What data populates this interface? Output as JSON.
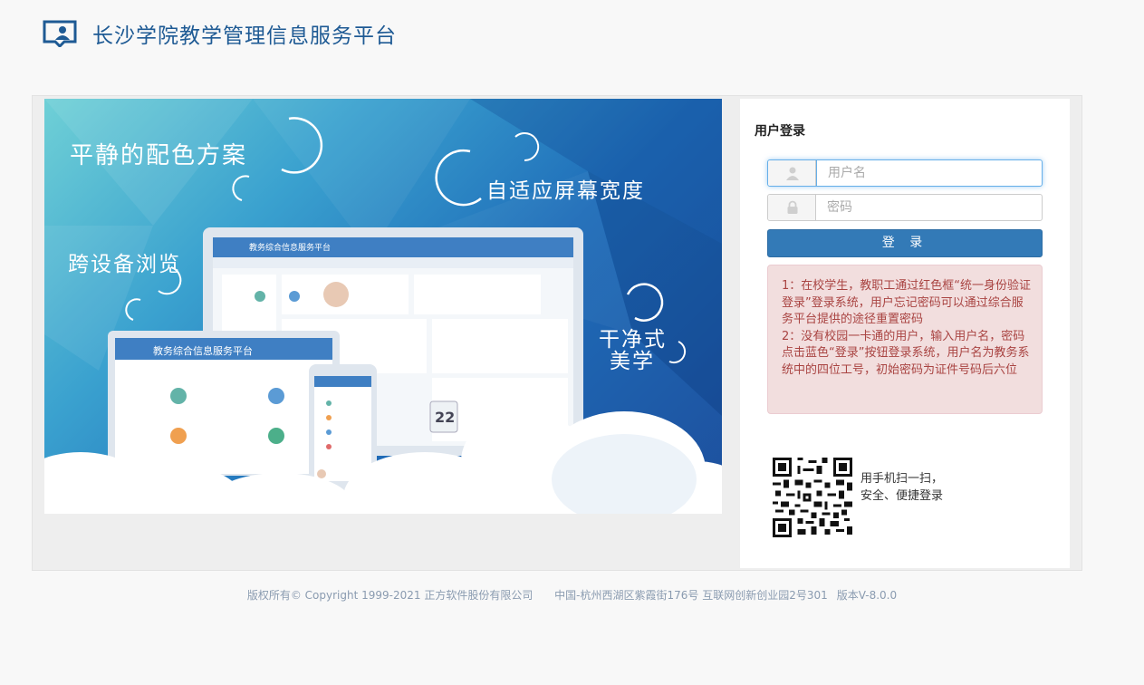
{
  "header": {
    "title": "长沙学院教学管理信息服务平台",
    "logo_icon": "monitor-user-icon"
  },
  "banner": {
    "slogans": [
      "平静的配色方案",
      "自适应屏幕宽度",
      "跨设备浏览",
      "干净式",
      "美学"
    ],
    "device_title": "教务综合信息服务平台",
    "date_number": "22"
  },
  "login": {
    "title": "用户登录",
    "username_placeholder": "用户名",
    "password_placeholder": "密码",
    "button_label": "登 录",
    "notice_1": "1：在校学生，教职工通过红色框“统一身份验证登录”登录系统，用户忘记密码可以通过综合服务平台提供的途径重置密码",
    "notice_2": "2：没有校园一卡通的用户，输入用户名，密码点击蓝色“登录”按钮登录系统，用户名为教务系统中的四位工号，初始密码为证件号码后六位",
    "qr_line1": "用手机扫一扫，",
    "qr_line2": "安全、便捷登录"
  },
  "footer": {
    "copyright": "版权所有© Copyright 1999-2021 正方软件股份有限公司",
    "address": "中国-杭州西湖区紫霞街176号 互联网创新创业园2号301",
    "version": "版本V-8.0.0"
  },
  "colors": {
    "brand_blue": "#1e5a94",
    "button_blue": "#337ab7",
    "notice_bg": "#f2dede",
    "notice_text": "#a94442"
  }
}
